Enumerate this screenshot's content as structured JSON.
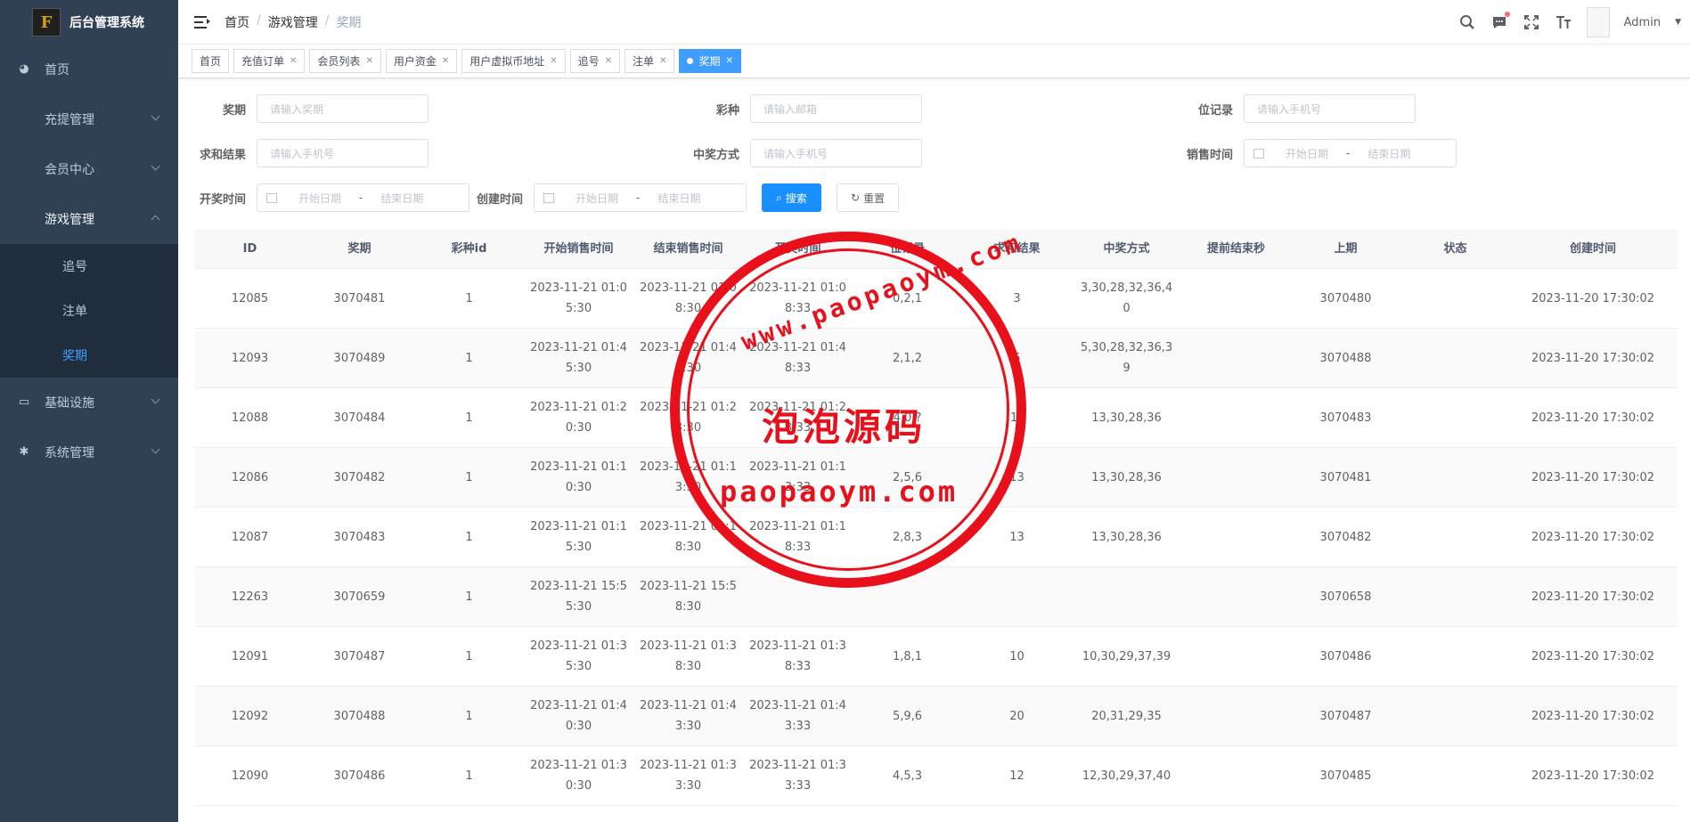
{
  "app": {
    "title": "后台管理系统",
    "logo_text": "F"
  },
  "sidebar": {
    "items": [
      {
        "label": "首页",
        "icon": "dashboard-icon"
      },
      {
        "label": "充提管理",
        "icon": ""
      },
      {
        "label": "会员中心",
        "icon": ""
      },
      {
        "label": "游戏管理",
        "icon": ""
      },
      {
        "label": "基础设施",
        "icon": "monitor-icon"
      },
      {
        "label": "系统管理",
        "icon": "gear-icon"
      }
    ],
    "sub_items": [
      {
        "label": "追号"
      },
      {
        "label": "注单"
      },
      {
        "label": "奖期"
      }
    ]
  },
  "navbar": {
    "breadcrumb": [
      "首页",
      "游戏管理",
      "奖期"
    ],
    "separator": "/",
    "user": "Admin"
  },
  "tags": [
    {
      "label": "首页"
    },
    {
      "label": "充值订单"
    },
    {
      "label": "会员列表"
    },
    {
      "label": "用户资金"
    },
    {
      "label": "用户虚拟币地址"
    },
    {
      "label": "追号"
    },
    {
      "label": "注单"
    },
    {
      "label": "奖期"
    }
  ],
  "filters": {
    "period": {
      "label": "奖期",
      "placeholder": "请输入奖期"
    },
    "lottery": {
      "label": "彩种",
      "placeholder": "请输入邮箱"
    },
    "position": {
      "label": "位记录",
      "placeholder": "请输入手机号"
    },
    "sum_result": {
      "label": "求和结果",
      "placeholder": "请输入手机号"
    },
    "win_method": {
      "label": "中奖方式",
      "placeholder": "请输入手机号"
    },
    "sale_time": {
      "label": "销售时间",
      "start": "开始日期",
      "end": "结束日期",
      "dash": "-"
    },
    "draw_time": {
      "label": "开奖时间",
      "start": "开始日期",
      "end": "结束日期",
      "dash": "-"
    },
    "create_time": {
      "label": "创建时间",
      "start": "开始日期",
      "end": "结束日期",
      "dash": "-"
    },
    "search_button": "搜索",
    "reset_button": "重置"
  },
  "table": {
    "headers": [
      "ID",
      "奖期",
      "彩种id",
      "开始销售时间",
      "结束销售时间",
      "开奖时间",
      "位记录",
      "求和结果",
      "中奖方式",
      "提前结束秒",
      "上期",
      "状态",
      "创建时间"
    ],
    "rows": [
      [
        "12085",
        "3070481",
        "1",
        "2023-11-21 01:05:30",
        "2023-11-21 01:08:30",
        "2023-11-21 01:08:33",
        "0,2,1",
        "3",
        "3,30,28,32,36,40",
        "",
        "3070480",
        "",
        "2023-11-20 17:30:02"
      ],
      [
        "12093",
        "3070489",
        "1",
        "2023-11-21 01:45:30",
        "2023-11-21 01:48:30",
        "2023-11-21 01:48:33",
        "2,1,2",
        "5",
        "5,30,28,32,36,39",
        "",
        "3070488",
        "",
        "2023-11-20 17:30:02"
      ],
      [
        "12088",
        "3070484",
        "1",
        "2023-11-21 01:20:30",
        "2023-11-21 01:23:30",
        "2023-11-21 01:23:33",
        "4,0,?",
        "1?",
        "13,30,28,36",
        "",
        "3070483",
        "",
        "2023-11-20 17:30:02"
      ],
      [
        "12086",
        "3070482",
        "1",
        "2023-11-21 01:10:30",
        "2023-11-21 01:13:30",
        "2023-11-21 01:13:33",
        "2,5,6",
        "13",
        "13,30,28,36",
        "",
        "3070481",
        "",
        "2023-11-20 17:30:02"
      ],
      [
        "12087",
        "3070483",
        "1",
        "2023-11-21 01:15:30",
        "2023-11-21 01:18:30",
        "2023-11-21 01:18:33",
        "2,8,3",
        "13",
        "13,30,28,36",
        "",
        "3070482",
        "",
        "2023-11-20 17:30:02"
      ],
      [
        "12263",
        "3070659",
        "1",
        "2023-11-21 15:55:30",
        "2023-11-21 15:58:30",
        "",
        "",
        "",
        "",
        "",
        "3070658",
        "",
        "2023-11-20 17:30:02"
      ],
      [
        "12091",
        "3070487",
        "1",
        "2023-11-21 01:35:30",
        "2023-11-21 01:38:30",
        "2023-11-21 01:38:33",
        "1,8,1",
        "10",
        "10,30,29,37,39",
        "",
        "3070486",
        "",
        "2023-11-20 17:30:02"
      ],
      [
        "12092",
        "3070488",
        "1",
        "2023-11-21 01:40:30",
        "2023-11-21 01:43:30",
        "2023-11-21 01:43:33",
        "5,9,6",
        "20",
        "20,31,29,35",
        "",
        "3070487",
        "",
        "2023-11-20 17:30:02"
      ],
      [
        "12090",
        "3070486",
        "1",
        "2023-11-21 01:30:30",
        "2023-11-21 01:33:30",
        "2023-11-21 01:33:33",
        "4,5,3",
        "12",
        "12,30,29,37,40",
        "",
        "3070485",
        "",
        "2023-11-20 17:30:02"
      ]
    ]
  },
  "watermark": {
    "line1": "www.paopaoym.com",
    "line2": "泡泡源码",
    "line3": "paopaoym.com",
    "color": "#e8101a"
  }
}
